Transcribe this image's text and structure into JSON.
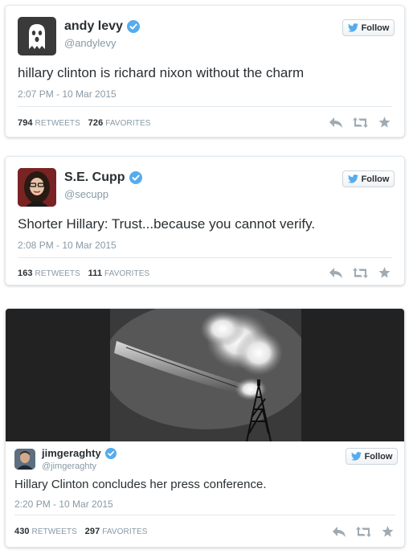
{
  "follow_label": "Follow",
  "colors": {
    "verified": "#55acee",
    "twitter_blue": "#55acee",
    "muted": "#8899a6",
    "action_icon": "#a0aab2"
  },
  "tweets": [
    {
      "name": "andy levy",
      "handle": "@andylevy",
      "text": "hillary clinton is richard nixon without the charm",
      "time": "2:07 PM - 10 Mar 2015",
      "retweets": "794",
      "retweets_label": "RETWEETS",
      "favorites": "726",
      "favorites_label": "FAVORITES",
      "avatar_icon": "ghost-icon"
    },
    {
      "name": "S.E. Cupp",
      "handle": "@secupp",
      "text": "Shorter Hillary: Trust...because you cannot verify.",
      "time": "2:08 PM - 10 Mar 2015",
      "retweets": "163",
      "retweets_label": "RETWEETS",
      "favorites": "111",
      "favorites_label": "FAVORITES",
      "avatar_icon": "portrait-icon"
    },
    {
      "name": "jimgeraghty",
      "handle": "@jimgeraghty",
      "text": "Hillary Clinton concludes her press conference.",
      "time": "2:20 PM - 10 Mar 2015",
      "retweets": "430",
      "retweets_label": "RETWEETS",
      "favorites": "297",
      "favorites_label": "FAVORITES",
      "avatar_icon": "portrait-icon",
      "media_icon": "burning-airship-photo"
    }
  ]
}
